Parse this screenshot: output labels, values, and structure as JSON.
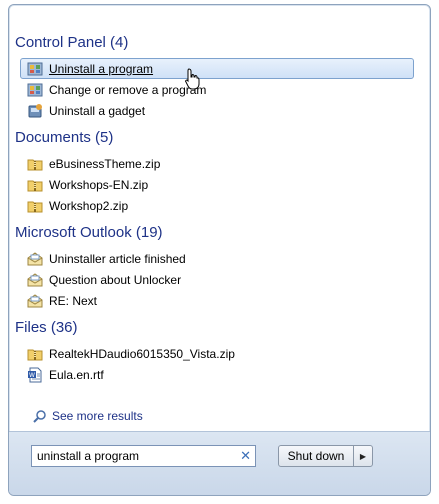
{
  "groups": [
    {
      "title": "Control Panel (4)",
      "items": [
        {
          "label": "Uninstall a program",
          "icon": "control-panel-icon"
        },
        {
          "label": "Change or remove a program",
          "icon": "control-panel-icon"
        },
        {
          "label": "Uninstall a gadget",
          "icon": "gadget-icon"
        }
      ]
    },
    {
      "title": "Documents (5)",
      "items": [
        {
          "label": "eBusinessTheme.zip",
          "icon": "zip-folder-icon"
        },
        {
          "label": "Workshops-EN.zip",
          "icon": "zip-folder-icon"
        },
        {
          "label": "Workshop2.zip",
          "icon": "zip-folder-icon"
        }
      ]
    },
    {
      "title": "Microsoft Outlook (19)",
      "items": [
        {
          "label": "Uninstaller article finished",
          "icon": "mail-icon"
        },
        {
          "label": "Question about Unlocker",
          "icon": "mail-icon"
        },
        {
          "label": "RE: Next",
          "icon": "mail-icon"
        }
      ]
    },
    {
      "title": "Files (36)",
      "items": [
        {
          "label": "RealtekHDaudio6015350_Vista.zip",
          "icon": "zip-folder-icon"
        },
        {
          "label": "Eula.en.rtf",
          "icon": "rtf-document-icon"
        }
      ]
    }
  ],
  "see_more": {
    "label": "See more results",
    "icon": "search-icon"
  },
  "search": {
    "value": "uninstall a program",
    "clear_icon": "close-icon"
  },
  "shutdown": {
    "label": "Shut down",
    "arrow_icon": "chevron-right-icon"
  },
  "colors": {
    "header": "#1e3287",
    "highlight_border": "#7da2ce"
  }
}
